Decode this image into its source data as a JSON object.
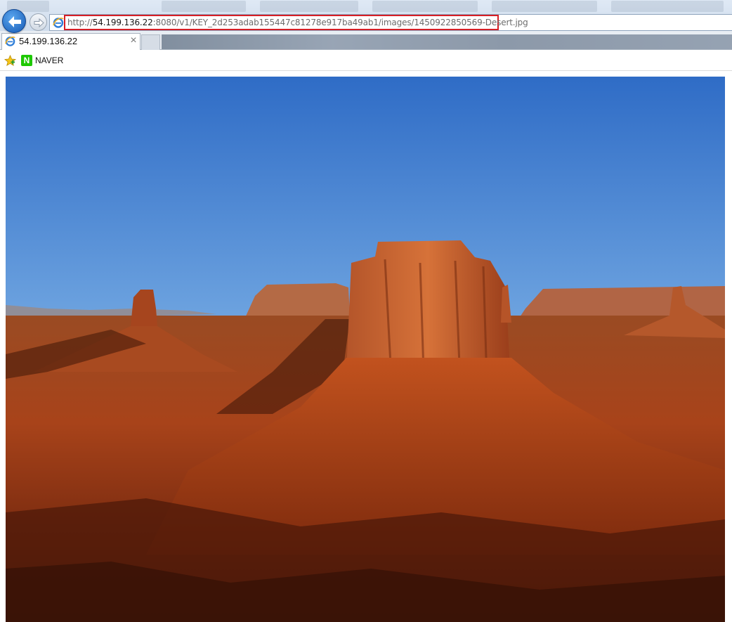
{
  "browser": {
    "url": {
      "prefix": "http://",
      "host": "54.199.136.22",
      "rest": ":8080/v1/KEY_2d253adab155447c81278e917ba49ab1/images/1450922850569-Desert.jpg"
    },
    "tab": {
      "title": "54.199.136.22",
      "close": "×"
    },
    "favorites": [
      {
        "label": "NAVER",
        "icon_letter": "N"
      }
    ]
  },
  "icons": {
    "back": "back-arrow-icon",
    "forward": "forward-arrow-icon",
    "page": "internet-explorer-icon",
    "favorites": "favorites-star-icon",
    "naver": "naver-logo-icon"
  },
  "colors": {
    "url_highlight": "#d61f26",
    "naver_green": "#1ec800",
    "back_button": "#1559b4"
  },
  "content": {
    "image_alt": "Desert"
  }
}
